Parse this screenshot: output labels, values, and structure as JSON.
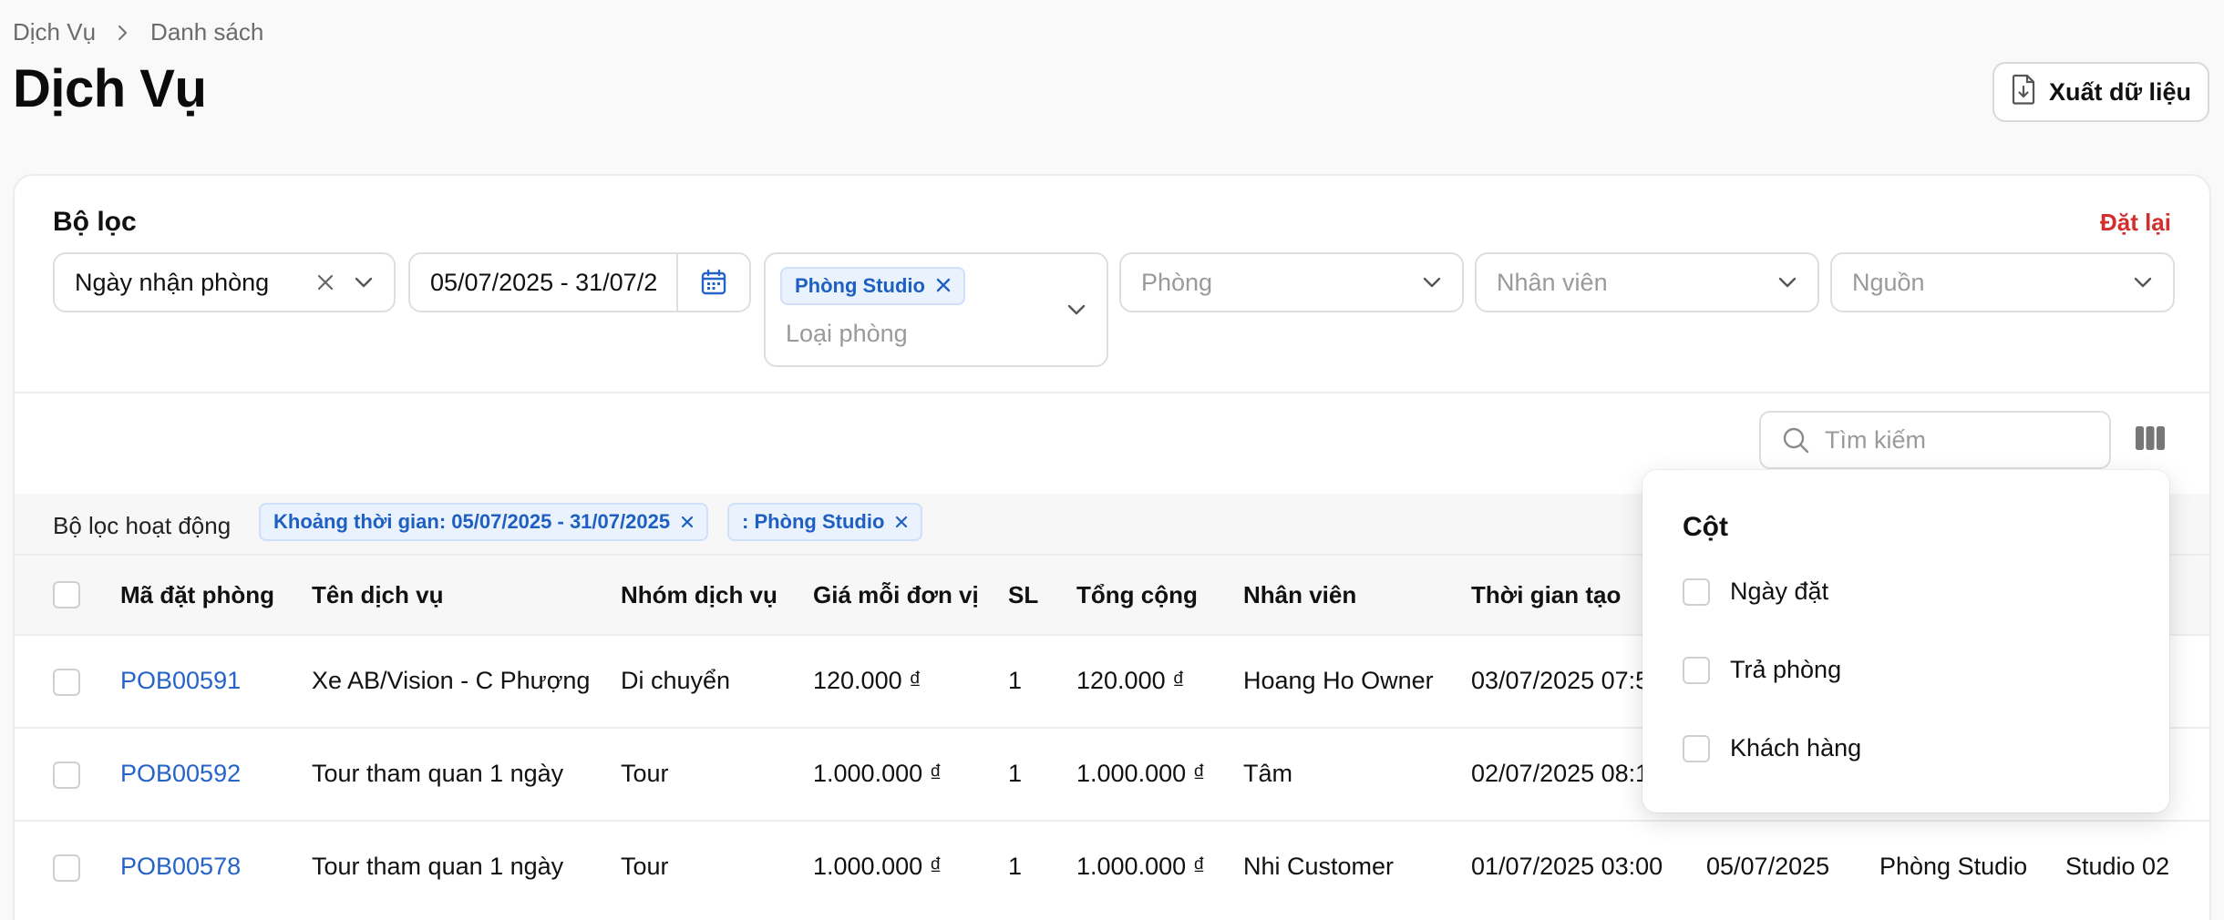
{
  "breadcrumb": {
    "root": "Dịch Vụ",
    "current": "Danh sách"
  },
  "page_title": "Dịch Vụ",
  "export_label": "Xuất dữ liệu",
  "filter": {
    "title": "Bộ lọc",
    "reset": "Đặt lại",
    "date_type": "Ngày nhận phòng",
    "date_range": "05/07/2025 - 31/07/2",
    "room_type_chip": "Phòng Studio",
    "room_type_placeholder": "Loại phòng",
    "room_placeholder": "Phòng",
    "staff_placeholder": "Nhân viên",
    "source_placeholder": "Nguồn"
  },
  "search": {
    "placeholder": "Tìm kiếm"
  },
  "active_filters": {
    "label": "Bộ lọc hoạt động",
    "chips": [
      "Khoảng thời gian: 05/07/2025 - 31/07/2025",
      ": Phòng Studio"
    ]
  },
  "table": {
    "headers": [
      "Mã đặt phòng",
      "Tên dịch vụ",
      "Nhóm dịch vụ",
      "Giá mỗi đơn vị",
      "SL",
      "Tổng cộng",
      "Nhân viên",
      "Thời gian tạo"
    ],
    "rows": [
      {
        "code": "POB00591",
        "service": "Xe AB/Vision - C Phượng",
        "group": "Di chuyển",
        "price": "120.000 ₫",
        "qty": "1",
        "total": "120.000 ₫",
        "staff": "Hoang Ho Owner",
        "created": "03/07/2025 07:5",
        "checkin": "",
        "room_type": "",
        "room": ""
      },
      {
        "code": "POB00592",
        "service": "Tour tham quan 1 ngày",
        "group": "Tour",
        "price": "1.000.000 ₫",
        "qty": "1",
        "total": "1.000.000 ₫",
        "staff": "Tâm",
        "created": "02/07/2025 08:1",
        "checkin": "",
        "room_type": "",
        "room": ""
      },
      {
        "code": "POB00578",
        "service": "Tour tham quan 1 ngày",
        "group": "Tour",
        "price": "1.000.000 ₫",
        "qty": "1",
        "total": "1.000.000 ₫",
        "staff": "Nhi Customer",
        "created": "01/07/2025 03:00",
        "checkin": "05/07/2025",
        "room_type": "Phòng Studio",
        "room": "Studio 02"
      }
    ]
  },
  "columns_menu": {
    "title": "Cột",
    "items": [
      "Ngày đặt",
      "Trả phòng",
      "Khách hàng"
    ]
  },
  "colors": {
    "accent": "#2563c9",
    "danger": "#d32f2f",
    "chip_bg": "#eaf2fd"
  }
}
